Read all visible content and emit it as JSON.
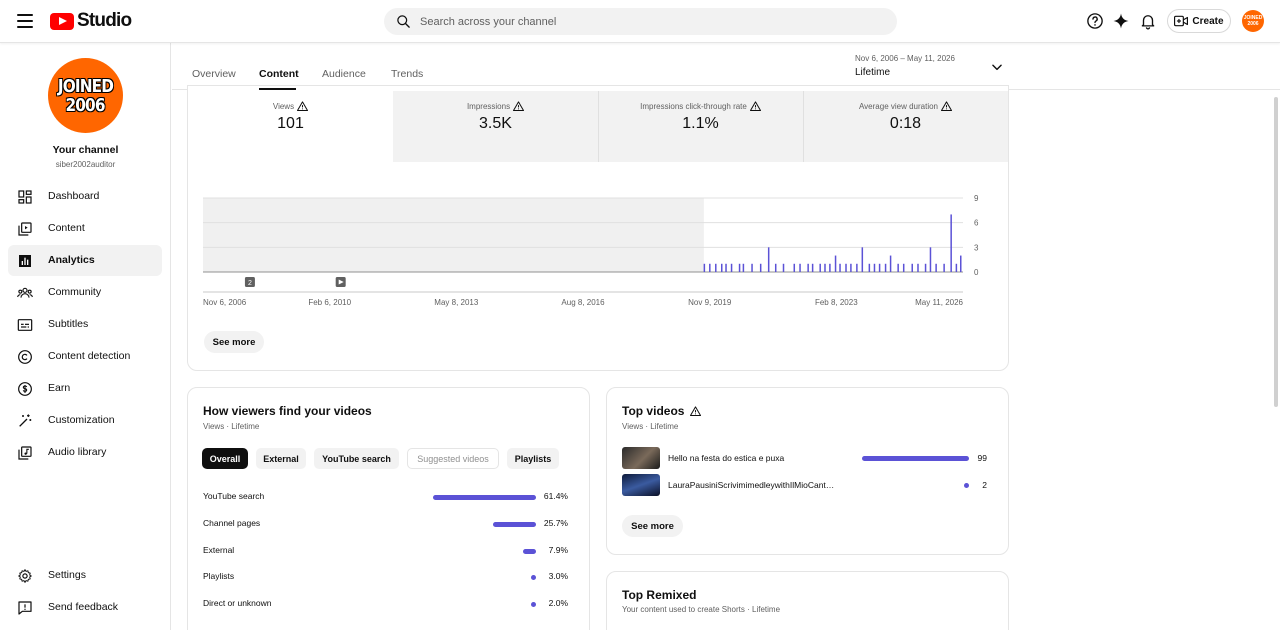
{
  "header": {
    "logo_text": "Studio",
    "search_placeholder": "Search across your channel",
    "create_label": "Create",
    "avatar_text": "JOINED 2006"
  },
  "sidebar": {
    "avatar_line1": "JOINED",
    "avatar_line2": "2006",
    "channel_label": "Your channel",
    "channel_handle": "siber2002auditor",
    "items": [
      {
        "label": "Dashboard",
        "icon": "dashboard-icon"
      },
      {
        "label": "Content",
        "icon": "content-icon"
      },
      {
        "label": "Analytics",
        "icon": "analytics-icon",
        "active": true
      },
      {
        "label": "Community",
        "icon": "community-icon"
      },
      {
        "label": "Subtitles",
        "icon": "subtitles-icon"
      },
      {
        "label": "Content detection",
        "icon": "copyright-icon"
      },
      {
        "label": "Earn",
        "icon": "dollar-icon"
      },
      {
        "label": "Customization",
        "icon": "magic-wand-icon"
      },
      {
        "label": "Audio library",
        "icon": "audio-library-icon"
      }
    ],
    "bottom_items": [
      {
        "label": "Settings",
        "icon": "gear-icon"
      },
      {
        "label": "Send feedback",
        "icon": "feedback-icon"
      }
    ]
  },
  "tabs": [
    "Overview",
    "Content",
    "Audience",
    "Trends"
  ],
  "active_tab": "Content",
  "date_filter": {
    "range": "Nov 6, 2006 – May 11, 2026",
    "period": "Lifetime"
  },
  "metrics": [
    {
      "label": "Views",
      "value": "101",
      "warning": true
    },
    {
      "label": "Impressions",
      "value": "3.5K",
      "warning": true
    },
    {
      "label": "Impressions click-through rate",
      "value": "1.1%",
      "warning": true
    },
    {
      "label": "Average view duration",
      "value": "0:18",
      "warning": true
    }
  ],
  "chart_data": {
    "type": "bar",
    "y_ticks": [
      "9",
      "6",
      "3",
      "0"
    ],
    "ylim": [
      0,
      9
    ],
    "x_tick_labels": [
      "Nov 6, 2006",
      "Feb 6, 2010",
      "May 8, 2013",
      "Aug 8, 2016",
      "Nov 9, 2019",
      "Feb 8, 2023",
      "May 11, 2026"
    ],
    "x_ticks": [
      "2006-11-06",
      "2010-02-06",
      "2013-05-08",
      "2016-08-08",
      "2019-11-09",
      "2023-02-08",
      "2026-05-11"
    ],
    "xlim": [
      "2006-11-06",
      "2026-05-11"
    ],
    "shaded_until": "2019-09-15",
    "markers": [
      {
        "date": "2008-01-20",
        "label": "2"
      },
      {
        "date": "2010-05-20",
        "label": "play"
      }
    ],
    "x": [
      "2019-09-20",
      "2019-11-10",
      "2020-01-05",
      "2020-03-01",
      "2020-04-10",
      "2020-06-01",
      "2020-08-15",
      "2020-09-20",
      "2020-12-10",
      "2021-03-01",
      "2021-05-15",
      "2021-07-20",
      "2021-10-01",
      "2022-01-10",
      "2022-03-05",
      "2022-05-20",
      "2022-07-01",
      "2022-09-10",
      "2022-10-25",
      "2022-12-10",
      "2023-02-01",
      "2023-03-15",
      "2023-05-10",
      "2023-06-25",
      "2023-08-20",
      "2023-10-10",
      "2023-12-15",
      "2024-02-01",
      "2024-03-20",
      "2024-05-15",
      "2024-07-01",
      "2024-09-10",
      "2024-11-01",
      "2025-01-20",
      "2025-03-15",
      "2025-05-25",
      "2025-07-10",
      "2025-09-01",
      "2025-11-15",
      "2026-01-20",
      "2026-03-10",
      "2026-04-20"
    ],
    "values": [
      1,
      1,
      1,
      1,
      1,
      1,
      1,
      1,
      1,
      1,
      3,
      1,
      1,
      1,
      1,
      1,
      1,
      1,
      1,
      1,
      2,
      1,
      1,
      1,
      1,
      3,
      1,
      1,
      1,
      1,
      2,
      1,
      1,
      1,
      1,
      1,
      3,
      1,
      1,
      7,
      1,
      2
    ],
    "color": "#5b52d6"
  },
  "see_more_label": "See more",
  "traffic_sources": {
    "title": "How viewers find your videos",
    "subtitle": "Views · Lifetime",
    "chips": [
      {
        "label": "Overall",
        "state": "active"
      },
      {
        "label": "External",
        "state": "normal"
      },
      {
        "label": "YouTube search",
        "state": "normal"
      },
      {
        "label": "Suggested videos",
        "state": "disabled"
      },
      {
        "label": "Playlists",
        "state": "normal"
      }
    ],
    "rows": [
      {
        "name": "YouTube search",
        "pct": "61.4%",
        "value": 61.4
      },
      {
        "name": "Channel pages",
        "pct": "25.7%",
        "value": 25.7
      },
      {
        "name": "External",
        "pct": "7.9%",
        "value": 7.9
      },
      {
        "name": "Playlists",
        "pct": "3.0%",
        "value": 3.0
      },
      {
        "name": "Direct or unknown",
        "pct": "2.0%",
        "value": 2.0
      }
    ]
  },
  "top_videos": {
    "title": "Top videos",
    "subtitle": "Views · Lifetime",
    "rows": [
      {
        "title": "Hello na festa do estica e puxa",
        "views": "99",
        "value": 99
      },
      {
        "title": "LauraPausiniScrivimimedleywithIlMioCant…",
        "views": "2",
        "value": 2
      }
    ]
  },
  "top_remixed": {
    "title": "Top Remixed",
    "subtitle": "Your content used to create Shorts · Lifetime"
  },
  "accent_color": "#5b52d6"
}
